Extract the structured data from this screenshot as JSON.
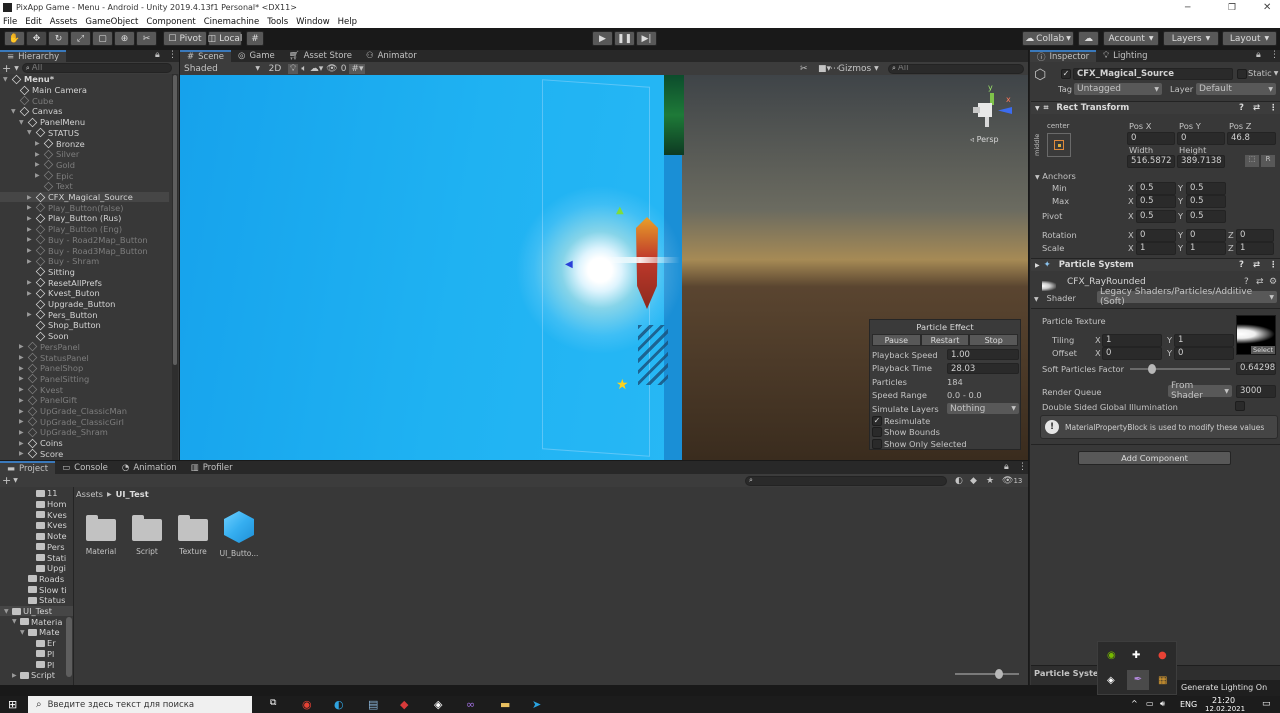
{
  "window": {
    "title": "PixApp Game - Menu - Android - Unity 2019.4.13f1 Personal* <DX11>"
  },
  "menu": [
    "File",
    "Edit",
    "Assets",
    "GameObject",
    "Component",
    "Cinemachine",
    "Tools",
    "Window",
    "Help"
  ],
  "toolbar": {
    "pivot": "Pivot",
    "local": "Local",
    "collab": "Collab",
    "account": "Account",
    "layers": "Layers",
    "layout": "Layout"
  },
  "hierarchy": {
    "title": "Hierarchy",
    "search": "All",
    "items": [
      {
        "label": "Menu*",
        "depth": 0,
        "arrow": "▼",
        "dim": false,
        "icon": "unity"
      },
      {
        "label": "Main Camera",
        "depth": 1,
        "arrow": "",
        "dim": false
      },
      {
        "label": "Cube",
        "depth": 1,
        "arrow": "",
        "dim": true
      },
      {
        "label": "Canvas",
        "depth": 1,
        "arrow": "▼",
        "dim": false
      },
      {
        "label": "PanelMenu",
        "depth": 2,
        "arrow": "▼",
        "dim": false
      },
      {
        "label": "STATUS",
        "depth": 3,
        "arrow": "▼",
        "dim": false
      },
      {
        "label": "Bronze",
        "depth": 4,
        "arrow": "▶",
        "dim": false
      },
      {
        "label": "Silver",
        "depth": 4,
        "arrow": "▶",
        "dim": true
      },
      {
        "label": "Gold",
        "depth": 4,
        "arrow": "▶",
        "dim": true
      },
      {
        "label": "Epic",
        "depth": 4,
        "arrow": "▶",
        "dim": true
      },
      {
        "label": "Text",
        "depth": 4,
        "arrow": "",
        "dim": true
      },
      {
        "label": "CFX_Magical_Source",
        "depth": 3,
        "arrow": "▶",
        "dim": false,
        "selected": true
      },
      {
        "label": "Play_Button(false)",
        "depth": 3,
        "arrow": "▶",
        "dim": true
      },
      {
        "label": "Play_Button (Rus)",
        "depth": 3,
        "arrow": "▶",
        "dim": false
      },
      {
        "label": "Play_Button (Eng)",
        "depth": 3,
        "arrow": "▶",
        "dim": true
      },
      {
        "label": "Buy - Road2Map_Button",
        "depth": 3,
        "arrow": "▶",
        "dim": true
      },
      {
        "label": "Buy - Road3Map_Button",
        "depth": 3,
        "arrow": "▶",
        "dim": true
      },
      {
        "label": "Buy - Shram",
        "depth": 3,
        "arrow": "▶",
        "dim": true
      },
      {
        "label": "Sitting",
        "depth": 3,
        "arrow": "",
        "dim": false
      },
      {
        "label": "ResetAllPrefs",
        "depth": 3,
        "arrow": "▶",
        "dim": false
      },
      {
        "label": "Kvest_Buton",
        "depth": 3,
        "arrow": "▶",
        "dim": false
      },
      {
        "label": "Upgrade_Button",
        "depth": 3,
        "arrow": "",
        "dim": false
      },
      {
        "label": "Pers_Button",
        "depth": 3,
        "arrow": "▶",
        "dim": false
      },
      {
        "label": "Shop_Button",
        "depth": 3,
        "arrow": "",
        "dim": false
      },
      {
        "label": "Soon",
        "depth": 3,
        "arrow": "",
        "dim": false
      },
      {
        "label": "PersPanel",
        "depth": 2,
        "arrow": "▶",
        "dim": true
      },
      {
        "label": "StatusPanel",
        "depth": 2,
        "arrow": "▶",
        "dim": true
      },
      {
        "label": "PanelShop",
        "depth": 2,
        "arrow": "▶",
        "dim": true
      },
      {
        "label": "PanelSitting",
        "depth": 2,
        "arrow": "▶",
        "dim": true
      },
      {
        "label": "Kvest",
        "depth": 2,
        "arrow": "▶",
        "dim": true
      },
      {
        "label": "PanelGift",
        "depth": 2,
        "arrow": "▶",
        "dim": true
      },
      {
        "label": "UpGrade_ClassicMan",
        "depth": 2,
        "arrow": "▶",
        "dim": true
      },
      {
        "label": "UpGrade_ClassicGirl",
        "depth": 2,
        "arrow": "▶",
        "dim": true
      },
      {
        "label": "UpGrade_Shram",
        "depth": 2,
        "arrow": "▶",
        "dim": true
      },
      {
        "label": "Coins",
        "depth": 2,
        "arrow": "▶",
        "dim": false
      },
      {
        "label": "Score",
        "depth": 2,
        "arrow": "▶",
        "dim": false
      }
    ]
  },
  "scene": {
    "tabs": [
      "Scene",
      "Game",
      "Asset Store",
      "Animator"
    ],
    "shading": "Shaded",
    "mode2d": "2D",
    "fx_count": "0",
    "gizmos": "Gizmos",
    "search": "All",
    "persp": "Persp",
    "axes": {
      "y": "y",
      "x": "x"
    }
  },
  "particle_effect": {
    "title": "Particle Effect",
    "buttons": [
      "Pause",
      "Restart",
      "Stop"
    ],
    "rows": [
      {
        "label": "Playback Speed",
        "value": "1.00",
        "field": true
      },
      {
        "label": "Playback Time",
        "value": "28.03",
        "field": true
      },
      {
        "label": "Particles",
        "value": "184",
        "field": false
      },
      {
        "label": "Speed Range",
        "value": "0.0 - 0.0",
        "field": false
      }
    ],
    "simulate_layers_label": "Simulate Layers",
    "simulate_layers_value": "Nothing",
    "checks": [
      {
        "label": "Resimulate",
        "checked": true
      },
      {
        "label": "Show Bounds",
        "checked": false
      },
      {
        "label": "Show Only Selected",
        "checked": false
      }
    ]
  },
  "project": {
    "tabs": [
      "Project",
      "Console",
      "Animation",
      "Profiler"
    ],
    "breadcrumb": [
      "Assets",
      "UI_Test"
    ],
    "badge": "13",
    "tree": [
      {
        "label": "11",
        "depth": 3
      },
      {
        "label": "Hom",
        "depth": 3
      },
      {
        "label": "Kves",
        "depth": 3
      },
      {
        "label": "Kves",
        "depth": 3
      },
      {
        "label": "Note",
        "depth": 3
      },
      {
        "label": "Pers",
        "depth": 3
      },
      {
        "label": "Stati",
        "depth": 3
      },
      {
        "label": "Upgi",
        "depth": 3
      },
      {
        "label": "Roads",
        "depth": 2
      },
      {
        "label": "Slow ti",
        "depth": 2
      },
      {
        "label": "Status",
        "depth": 2
      },
      {
        "label": "UI_Test",
        "depth": 0,
        "arrow": "▼",
        "selected": true
      },
      {
        "label": "Materia",
        "depth": 1,
        "arrow": "▼"
      },
      {
        "label": "Mate",
        "depth": 2,
        "arrow": "▼"
      },
      {
        "label": "Er",
        "depth": 3
      },
      {
        "label": "Pl",
        "depth": 3
      },
      {
        "label": "Pl",
        "depth": 3
      },
      {
        "label": "Script",
        "depth": 1,
        "arrow": "▶"
      }
    ],
    "assets": [
      {
        "label": "Material",
        "kind": "folder"
      },
      {
        "label": "Script",
        "kind": "folder"
      },
      {
        "label": "Texture",
        "kind": "folder"
      },
      {
        "label": "UI_Butto...",
        "kind": "prefab"
      }
    ]
  },
  "inspector": {
    "tabs": [
      "Inspector",
      "Lighting"
    ],
    "object_name": "CFX_Magical_Source",
    "static_label": "Static",
    "tag_label": "Tag",
    "tag_value": "Untagged",
    "layer_label": "Layer",
    "layer_value": "Default",
    "rect_transform": {
      "title": "Rect Transform",
      "anchor_h": "center",
      "anchor_v": "middle",
      "pos_x_label": "Pos X",
      "pos_y_label": "Pos Y",
      "pos_z_label": "Pos Z",
      "pos_x": "0",
      "pos_y": "0",
      "pos_z": "46.8",
      "width_label": "Width",
      "height_label": "Height",
      "width": "516.5872",
      "height": "389.7138",
      "anchors_label": "Anchors",
      "min_label": "Min",
      "max_label": "Max",
      "pivot_label": "Pivot",
      "rotation_label": "Rotation",
      "scale_label": "Scale",
      "x": "X",
      "y": "Y",
      "z": "Z",
      "min": [
        "0.5",
        "0.5"
      ],
      "max": [
        "0.5",
        "0.5"
      ],
      "pivot": [
        "0.5",
        "0.5"
      ],
      "rotation": [
        "0",
        "0",
        "0"
      ],
      "scale": [
        "1",
        "1",
        "1"
      ]
    },
    "particle_system": {
      "title": "Particle System",
      "material": "CFX_RayRounded",
      "shader_label": "Shader",
      "shader_value": "Legacy Shaders/Particles/Additive (Soft)",
      "texture_label": "Particle Texture",
      "tiling_label": "Tiling",
      "offset_label": "Offset",
      "tiling": [
        "1",
        "1"
      ],
      "offset": [
        "0",
        "0"
      ],
      "select_label": "Select",
      "soft_label": "Soft Particles Factor",
      "soft_value": "0.642985",
      "soft_fraction": 0.2,
      "queue_label": "Render Queue",
      "queue_mode": "From Shader",
      "queue_value": "3000",
      "double_sided_label": "Double Sided Global Illumination",
      "info": "MaterialPropertyBlock is used to modify these values"
    },
    "add_component": "Add Component",
    "footer": "Particle System"
  },
  "taskbar": {
    "search_placeholder": "Введите здесь текст для поиска",
    "lang": "ENG",
    "time": "21:20",
    "date": "12.02.2021",
    "notification": "Generate Lighting On"
  }
}
